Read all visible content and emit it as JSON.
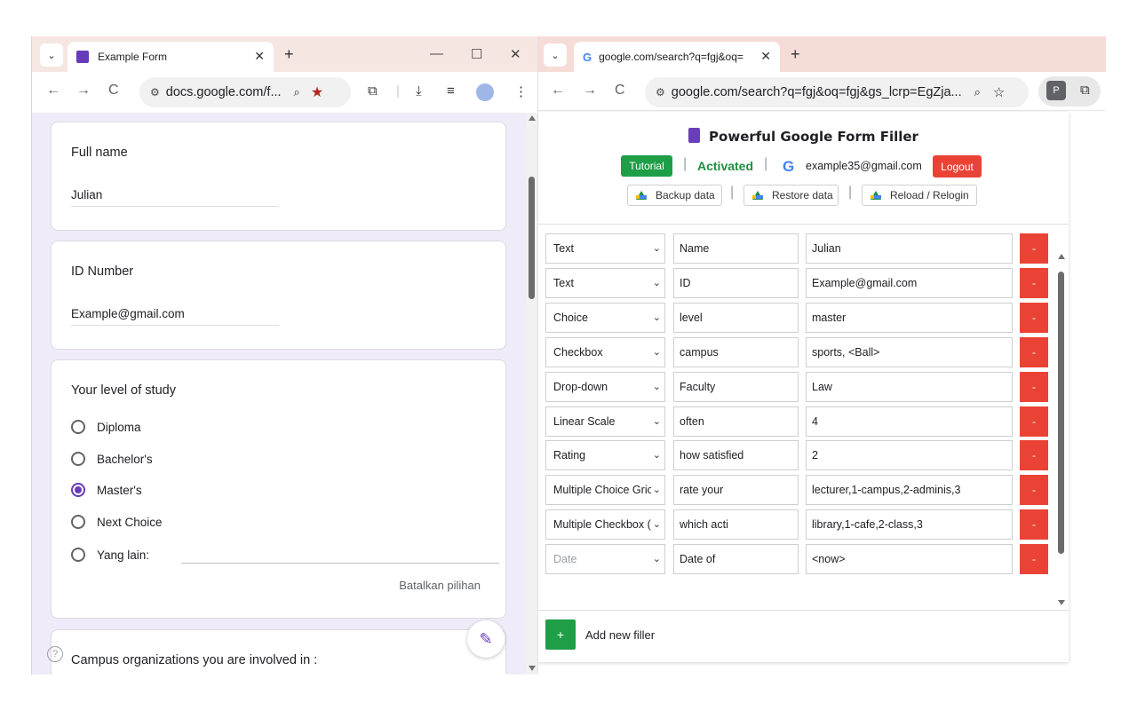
{
  "left_window": {
    "tab_title": "Example Form",
    "url": "docs.google.com/f...",
    "form": {
      "q1": {
        "title": "Full name",
        "answer": "Julian"
      },
      "q2": {
        "title": "ID Number",
        "answer": "Example@gmail.com"
      },
      "q3": {
        "title": "Your level of study",
        "options": [
          "Diploma",
          "Bachelor's",
          "Master's",
          "Next Choice",
          "Yang lain:"
        ],
        "selected": "Master's",
        "clear_label": "Batalkan pilihan"
      },
      "q4": {
        "title": "Campus organizations you are involved in :"
      }
    }
  },
  "right_window": {
    "tab_title": "google.com/search?q=fgj&oq=",
    "url": "google.com/search?q=fgj&oq=fgj&gs_lcrp=EgZja...",
    "ext_badge": "P",
    "popup": {
      "title": "Powerful Google Form Filler",
      "tutorial_label": "Tutorial",
      "status": "Activated",
      "account_email": "example35@gmail.com",
      "logout_label": "Logout",
      "backup_label": "Backup data",
      "restore_label": "Restore data",
      "reload_label": "Reload / Relogin",
      "delete_label": "-",
      "add_label": "Add new filler",
      "add_symbol": "+",
      "rows": [
        {
          "type": "Text",
          "name": "Name",
          "value": "Julian"
        },
        {
          "type": "Text",
          "name": "ID",
          "value": "Example@gmail.com"
        },
        {
          "type": "Choice",
          "name": "level",
          "value": "master"
        },
        {
          "type": "Checkbox",
          "name": "campus",
          "value": "sports, <Ball>"
        },
        {
          "type": "Drop-down",
          "name": "Faculty",
          "value": "Law"
        },
        {
          "type": "Linear Scale",
          "name": "often",
          "value": "4"
        },
        {
          "type": "Rating",
          "name": "how satisfied",
          "value": "2"
        },
        {
          "type": "Multiple Choice Gric",
          "name": "rate your",
          "value": "lecturer,1-campus,2-adminis,3"
        },
        {
          "type": "Multiple Checkbox (",
          "name": "which acti",
          "value": "library,1-cafe,2-class,3"
        },
        {
          "type": "Date",
          "name": "Date of",
          "value": "<now>"
        }
      ]
    }
  }
}
